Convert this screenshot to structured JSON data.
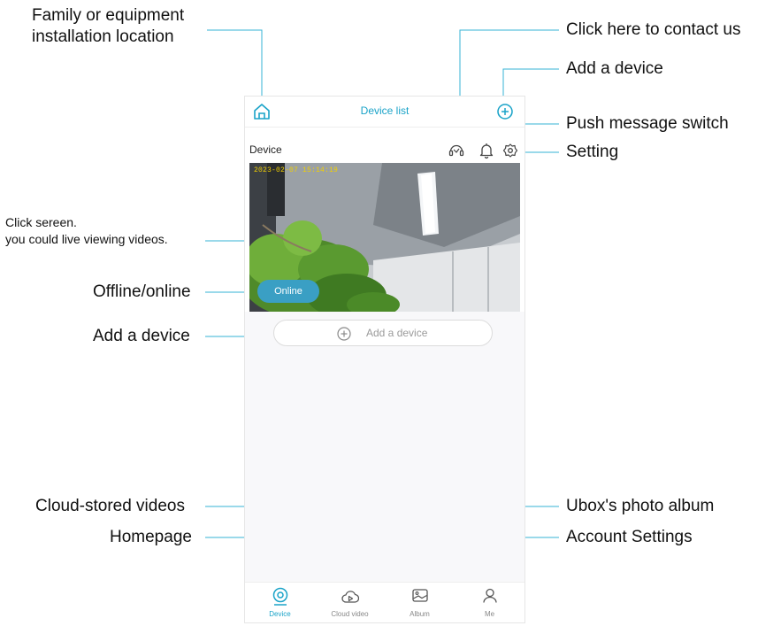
{
  "callouts": {
    "family_location_line1": "Family or equipment",
    "family_location_line2": "installation location",
    "contact_us": "Click here to contact us",
    "add_device_top": "Add a device",
    "push_switch": "Push message switch",
    "setting": "Setting",
    "click_screen_line1": "Click sereen.",
    "click_screen_line2": "you could live viewing videos.",
    "offline_online": "Offline/online",
    "add_device_row": "Add a device",
    "cloud_videos": "Cloud-stored videos",
    "homepage": "Homepage",
    "photo_album": "Ubox's photo album",
    "account_settings": "Account Settings"
  },
  "app": {
    "header_title": "Device list",
    "device_name": "Device",
    "timestamp": "2023-02-07 15:14:19",
    "status": "Online",
    "add_device_label": "Add a device",
    "tabs": [
      {
        "label": "Device",
        "icon": "camera-icon",
        "active": true
      },
      {
        "label": "Cloud video",
        "icon": "cloud-play-icon",
        "active": false
      },
      {
        "label": "Album",
        "icon": "album-icon",
        "active": false
      },
      {
        "label": "Me",
        "icon": "person-icon",
        "active": false
      }
    ]
  },
  "colors": {
    "accent": "#1aa3c8",
    "status_pill": "#3a9fc4",
    "leader_line": "#36b3d6"
  }
}
